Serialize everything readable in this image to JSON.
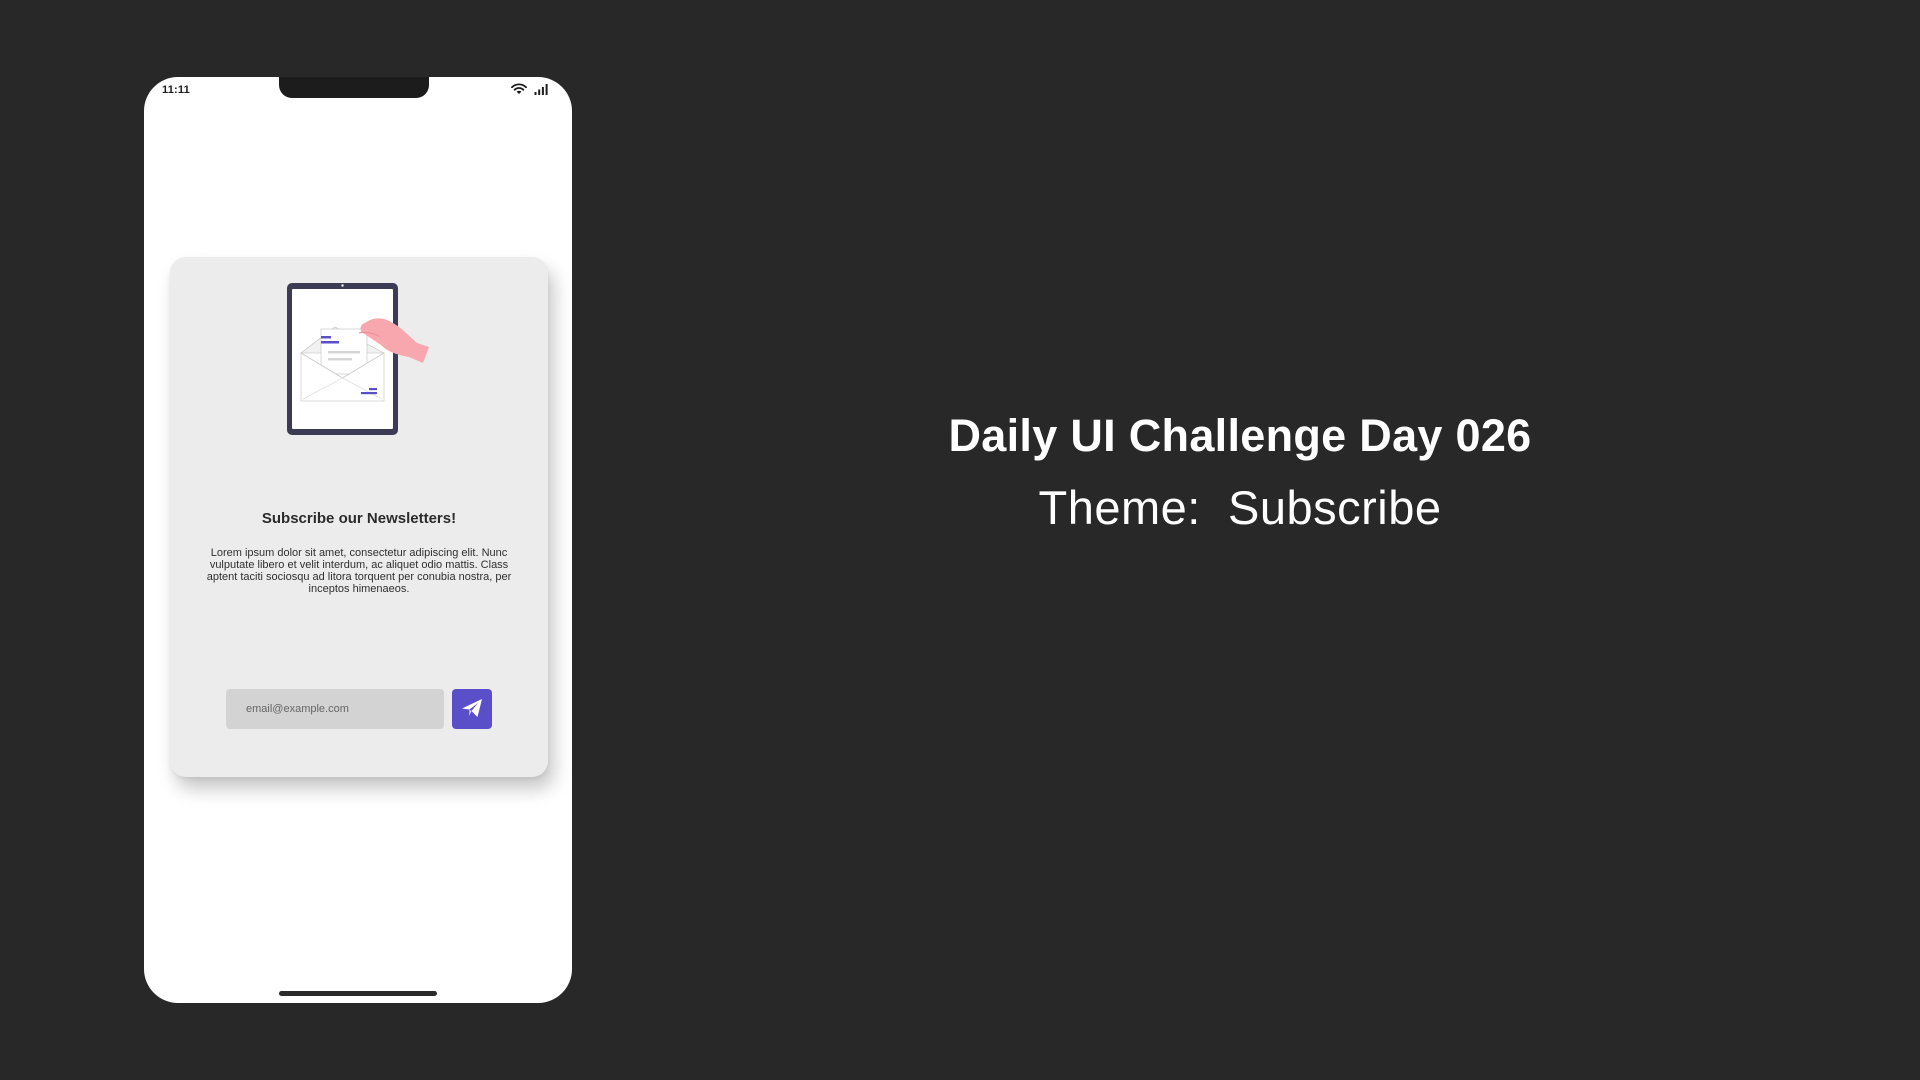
{
  "phone": {
    "status_time": "11:11",
    "status_icons": [
      "wifi-icon",
      "signal-icon"
    ],
    "card": {
      "illustration": "tablet-envelope-illustration",
      "title": "Subscribe our Newsletters!",
      "description": "Lorem ipsum dolor sit amet, consectetur adipiscing elit. Nunc vulputate libero et velit interdum, ac aliquet odio mattis. Class aptent taciti sociosqu ad litora torquent per conubia nostra, per inceptos himenaeos.",
      "email_placeholder": "email@example.com",
      "email_value": "",
      "send_icon": "paper-plane-icon"
    }
  },
  "headline": "Daily UI Challenge Day 026",
  "theme_line": "Theme:  Subscribe",
  "colors": {
    "background": "#282828",
    "accent": "#5a4fc8",
    "card": "#ececec",
    "input": "#d3d3d3"
  }
}
